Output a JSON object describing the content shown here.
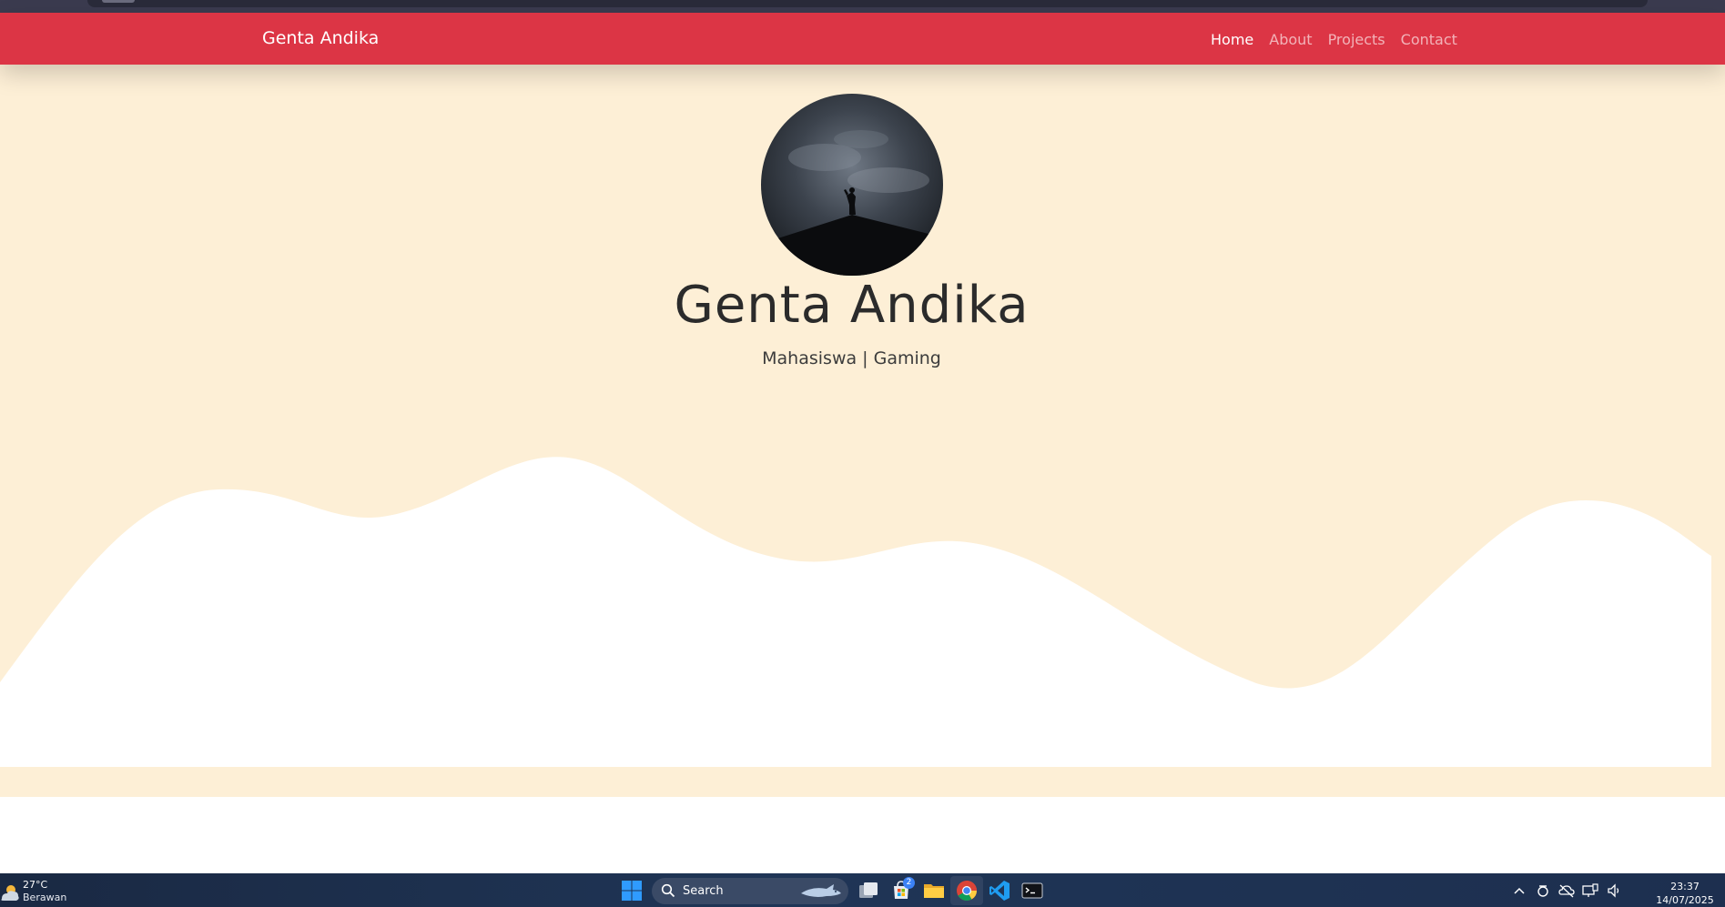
{
  "navbar": {
    "brand": "Genta Andika",
    "links": [
      {
        "label": "Home",
        "active": true
      },
      {
        "label": "About",
        "active": false
      },
      {
        "label": "Projects",
        "active": false
      },
      {
        "label": "Contact",
        "active": false
      }
    ]
  },
  "hero": {
    "name": "Genta Andika",
    "subtitle": "Mahasiswa | Gaming"
  },
  "colors": {
    "navbar": "#dc3545",
    "hero_bg": "#fdefd6",
    "wave": "#ffffff",
    "taskbar": "#1f3556"
  },
  "taskbar": {
    "weather": {
      "temp": "27°C",
      "desc": "Berawan"
    },
    "search_label": "Search",
    "store_badge": "2",
    "apps": [
      "windows-start-icon",
      "search-icon",
      "task-view-icon",
      "microsoft-store-icon",
      "file-explorer-icon",
      "chrome-icon",
      "vscode-icon",
      "terminal-icon"
    ],
    "tray": [
      "chevron-up-icon",
      "onedrive-icon",
      "cloud-offline-icon",
      "network-icon",
      "volume-icon"
    ],
    "time": "23:37",
    "date": "14/07/2025"
  }
}
